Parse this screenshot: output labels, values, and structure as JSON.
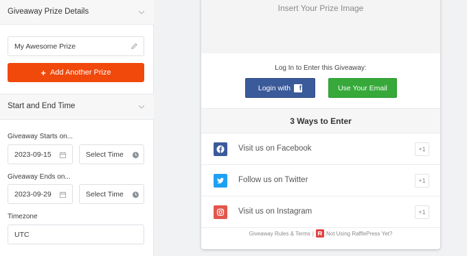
{
  "left_panel": {
    "prize_section": {
      "title": "Giveaway Prize Details",
      "prize_name": "My Awesome Prize",
      "add_button": "Add Another Prize",
      "add_button_color": "#f1480b"
    },
    "time_section": {
      "title": "Start and End Time",
      "start_label": "Giveaway Starts on...",
      "start_date": "2023-09-15",
      "start_time": "Select Time",
      "end_label": "Giveaway Ends on...",
      "end_date": "2023-09-29",
      "end_time": "Select Time",
      "timezone_label": "Timezone",
      "timezone": "UTC"
    }
  },
  "preview": {
    "image_placeholder": "Insert Your Prize Image",
    "login_text": "Log In to Enter this Giveaway:",
    "fb_login_label": "Login with",
    "email_login_label": "Use Your Email",
    "ways_title": "3 Ways to Enter",
    "entries": [
      {
        "label": "Visit us on Facebook",
        "points": "+1",
        "icon": "facebook-icon",
        "color": "#3b5a9a"
      },
      {
        "label": "Follow us on Twitter",
        "points": "+1",
        "icon": "twitter-icon",
        "color": "#1da1f2"
      },
      {
        "label": "Visit us on Instagram",
        "points": "+1",
        "icon": "instagram-icon",
        "color": "#e2574c"
      }
    ],
    "footer": {
      "rules": "Giveaway Rules & Terms",
      "separator": "|",
      "promo": "Not Using RafflePress Yet?"
    }
  }
}
